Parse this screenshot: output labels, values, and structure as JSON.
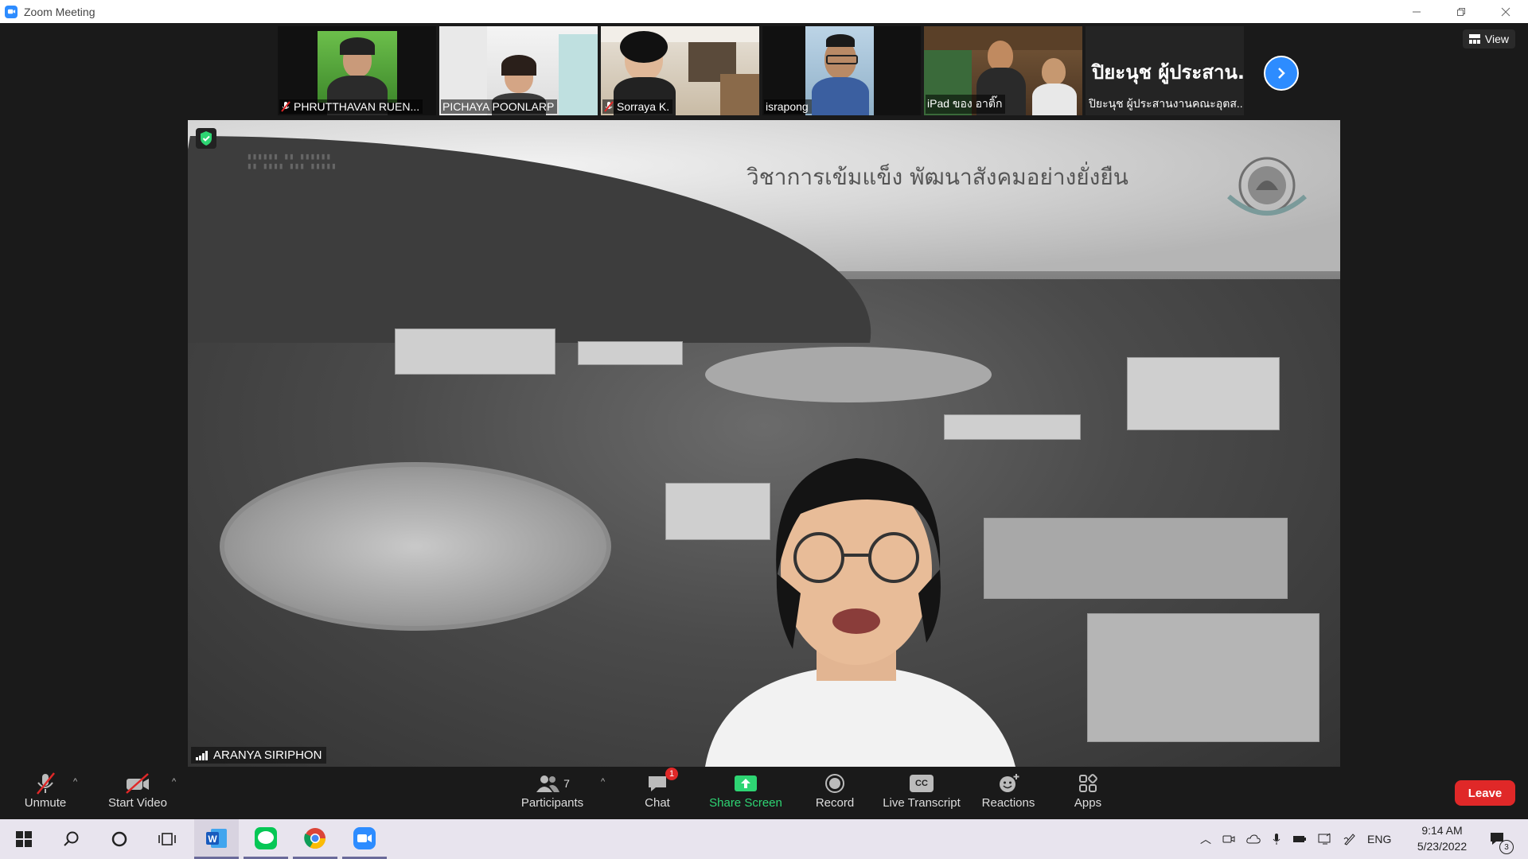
{
  "window": {
    "title": "Zoom Meeting"
  },
  "filmstrip": {
    "tiles": [
      {
        "name": "PHRUTTHAVAN RUEN...",
        "muted": true
      },
      {
        "name": "PICHAYA POONLARP",
        "muted": false
      },
      {
        "name": "Sorraya K.",
        "muted": true
      },
      {
        "name": "israpong",
        "muted": false
      },
      {
        "name": "iPad ของ อาติ๊ก",
        "muted": false
      },
      {
        "name": "ปิยะนุช ผู้ประสานงานคณะอุตส...",
        "display_text": "ปิยะนุช ผู้ประสาน...",
        "muted": false
      }
    ]
  },
  "view_button": {
    "label": "View"
  },
  "main_video": {
    "speaker_name": "ARANYA SIRIPHON",
    "background_text": "วิชาการเข้มแข็ง พัฒนาสังคมอย่างยั่งยืน"
  },
  "toolbar": {
    "unmute": "Unmute",
    "start_video": "Start Video",
    "participants": "Participants",
    "participants_count": "7",
    "chat": "Chat",
    "chat_badge": "1",
    "share_screen": "Share Screen",
    "record": "Record",
    "live_transcript": "Live Transcript",
    "cc": "CC",
    "reactions": "Reactions",
    "apps": "Apps",
    "leave": "Leave"
  },
  "taskbar": {
    "language": "ENG",
    "time": "9:14 AM",
    "date": "5/23/2022",
    "notification_count": "3"
  },
  "colors": {
    "accent": "#2d8cff",
    "leave": "#e02828",
    "share": "#2ed573"
  }
}
